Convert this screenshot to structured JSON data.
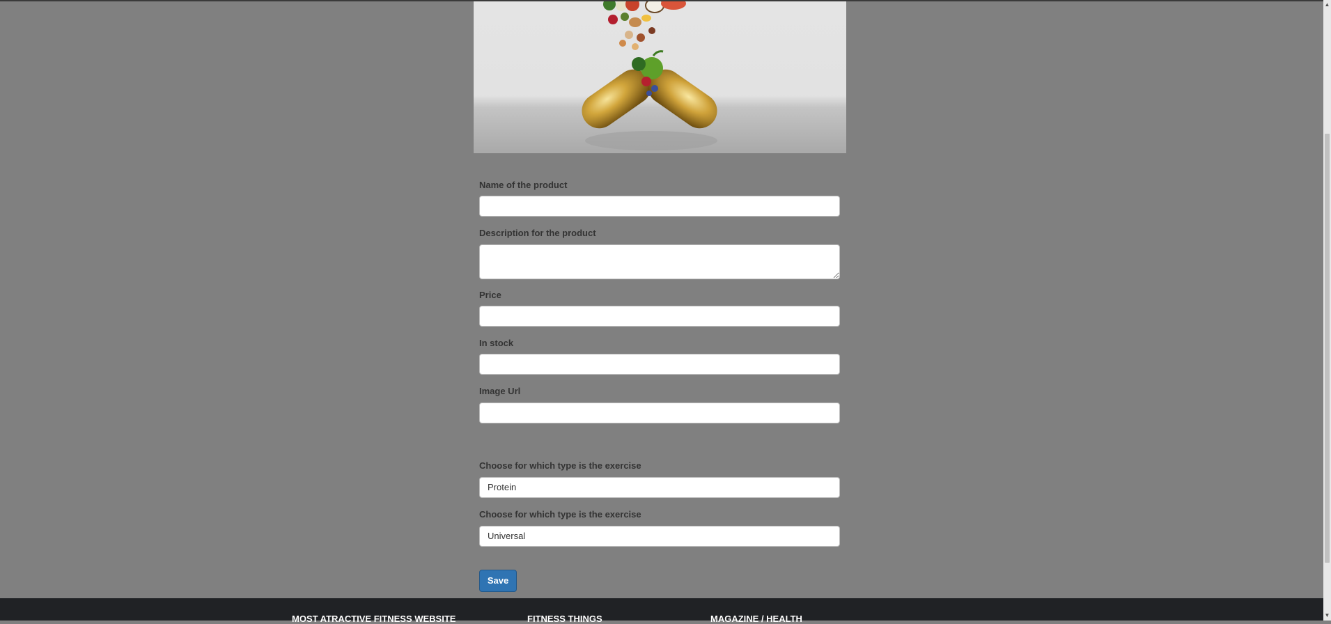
{
  "form": {
    "name_label": "Name of the product",
    "name_value": "",
    "description_label": "Description for the product",
    "description_value": "",
    "price_label": "Price",
    "price_value": "",
    "stock_label": "In stock",
    "stock_value": "",
    "image_url_label": "Image Url",
    "image_url_value": "",
    "type_label": "Choose for which type is the exercise",
    "type_value": "Protein",
    "category_label": "Choose for which type is the exercise",
    "category_value": "Universal",
    "save_label": "Save"
  },
  "footer": {
    "col1": "MOST ATRACTIVE FITNESS WEBSITE",
    "col2": "FITNESS THINGS",
    "col3": "MAGAZINE / HEALTH"
  },
  "colors": {
    "page_bg": "#808080",
    "primary_button": "#2f74b3",
    "footer_bg": "#202225"
  },
  "icons": {
    "scroll_up": "scroll-up-arrow-icon",
    "scroll_down": "scroll-down-arrow-icon"
  }
}
